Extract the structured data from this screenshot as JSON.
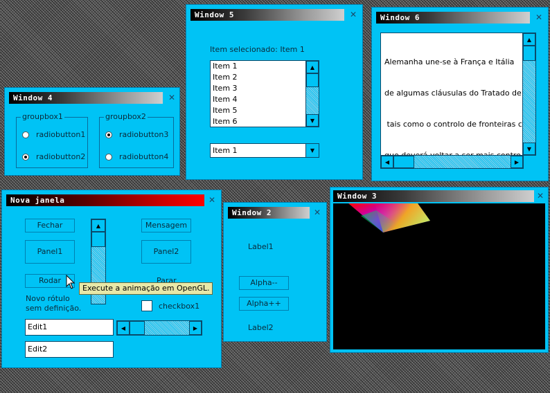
{
  "window4": {
    "title": "Window 4",
    "groupbox1": {
      "title": "groupbox1",
      "radio1": "radiobutton1",
      "radio2": "radiobutton2"
    },
    "groupbox2": {
      "title": "groupbox2",
      "radio3": "radiobutton3",
      "radio4": "radiobutton4"
    }
  },
  "window5": {
    "title": "Window 5",
    "selected_label": "Item selecionado: Item 1",
    "list_items": [
      "Item 1",
      "Item 2",
      "Item 3",
      "Item 4",
      "Item 5",
      "Item 6"
    ],
    "combo_value": "Item 1"
  },
  "window6": {
    "title": "Window 6",
    "text_lines": [
      "Alemanha une-se à França e Itália",
      "de algumas cláusulas do Tratado de",
      " tais como o controlo de fronteiras c",
      "que deverá voltar a ser mais contro"
    ]
  },
  "nova": {
    "title": "Nova janela",
    "fechar": "Fechar",
    "panel1": "Panel1",
    "rodar": "Rodar",
    "novo_rotulo_line1": "Novo rótulo",
    "novo_rotulo_line2": "sem definição.",
    "edit1": "Edit1",
    "edit2": "Edit2",
    "mensagem": "Mensagem",
    "panel2": "Panel2",
    "parar": "Parar",
    "checkbox1": "checkbox1",
    "tooltip": "Execute a animação em OpenGL."
  },
  "window2": {
    "title": "Window 2",
    "label1": "Label1",
    "alpha_minus": "Alpha--",
    "alpha_plus": "Alpha++",
    "label2": "Label2"
  },
  "window3": {
    "title": "Window 3"
  },
  "colors": {
    "window_bg": "#00c3f5",
    "tooltip_bg": "#e8e8a8",
    "canvas_bg": "#000000"
  }
}
